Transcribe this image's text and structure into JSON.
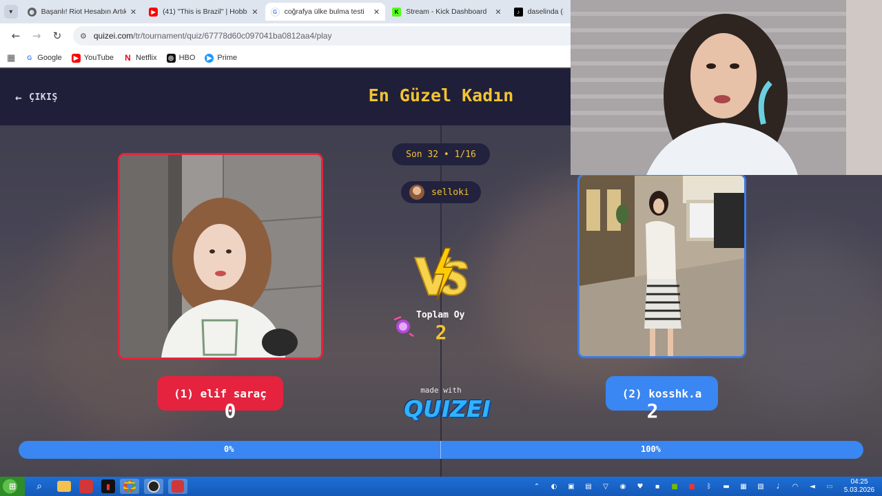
{
  "browser": {
    "tabs": [
      {
        "label": "Başanlı! Riot Hesabın Artık",
        "favicon": "globe-icon",
        "active": false
      },
      {
        "label": "(41) \"This is Brazil\" | Hobbs",
        "favicon": "youtube-icon",
        "active": false
      },
      {
        "label": "coğrafya ülke bulma testi",
        "favicon": "google-icon",
        "active": true
      },
      {
        "label": "Stream - Kick Dashboard",
        "favicon": "kick-icon",
        "active": false
      },
      {
        "label": "daselinda (@",
        "favicon": "tiktok-icon",
        "active": false
      }
    ],
    "url_host": "quizei.com",
    "url_path": "/tr/tournament/quiz/67778d60c097041ba0812aa4/play",
    "bookmarks": [
      {
        "label": "Google",
        "icon": "google-icon",
        "color": "#4285f4"
      },
      {
        "label": "YouTube",
        "icon": "youtube-icon",
        "color": "#ff0000"
      },
      {
        "label": "Netflix",
        "icon": "netflix-icon",
        "color": "#e50914"
      },
      {
        "label": "HBO",
        "icon": "hbo-icon",
        "color": "#111111"
      },
      {
        "label": "Prime",
        "icon": "prime-icon",
        "color": "#1a98ff"
      }
    ]
  },
  "quiz": {
    "exit_label": "ÇIKIŞ",
    "title": "En Güzel Kadın",
    "round": "Son 32 • 1/16",
    "username": "selloki",
    "total_label": "Toplam Oy",
    "total_votes": "2",
    "made_with": "made with",
    "brand": "QUIZEI",
    "left": {
      "name": "(1) elif saraç",
      "votes": "0",
      "percent": "0%",
      "color": "#e5233e"
    },
    "right": {
      "name": "(2) kosshk.a",
      "votes": "2",
      "percent": "100%",
      "color": "#3a86f2"
    },
    "accent_color": "#f4c430"
  },
  "taskbar": {
    "time": "04:25",
    "date": "5.03.2026"
  }
}
